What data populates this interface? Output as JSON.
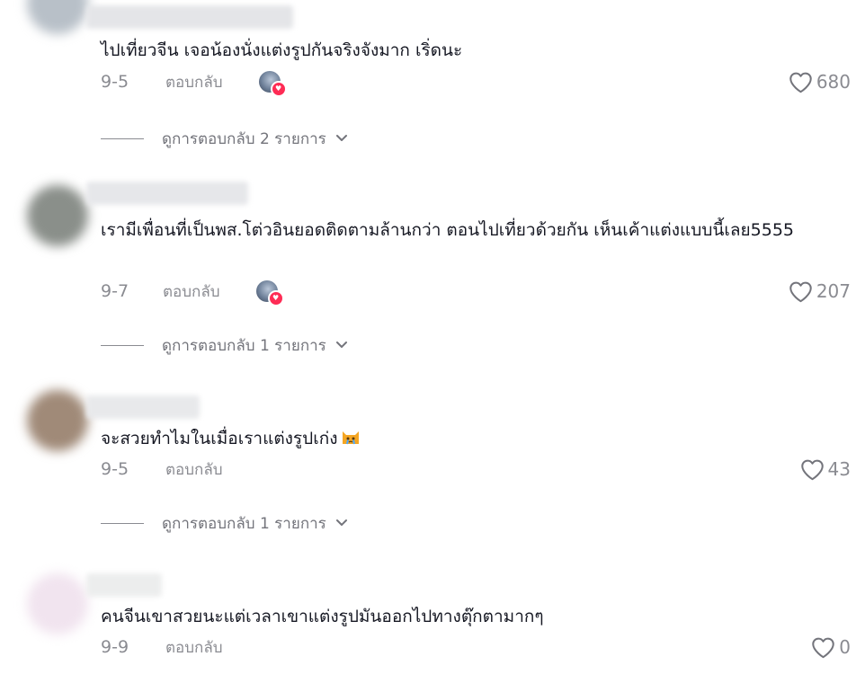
{
  "comments": [
    {
      "text": "ไปเที่ยวจีน เจอน้องนั่งแต่งรูปกันจริงจังมาก เริ่ดนะ",
      "date": "9-5",
      "reply_label": "ตอบกลับ",
      "creator_liked": true,
      "likes": "680",
      "view_replies": "ดูการตอบกลับ 2 รายการ"
    },
    {
      "text": "เรามีเพื่อนที่เป็นพส.โต่วอินยอดติดตามล้านกว่า ตอนไปเที่ยวด้วยกัน เห็นเค้าแต่งแบบนี้เลย5555",
      "date": "9-7",
      "reply_label": "ตอบกลับ",
      "creator_liked": true,
      "likes": "207",
      "view_replies": "ดูการตอบกลับ 1 รายการ"
    },
    {
      "text": "จะสวยทำไมในเมื่อเราแต่งรูปเก่ง",
      "emoji": "crying-cat-emoji",
      "date": "9-5",
      "reply_label": "ตอบกลับ",
      "creator_liked": false,
      "likes": "43",
      "view_replies": "ดูการตอบกลับ 1 รายการ"
    },
    {
      "text": "คนจีนเขาสวยนะแต่เวลาเขาแต่งรูปมันออกไปทางตุ๊กตามากๆ",
      "date": "9-9",
      "reply_label": "ตอบกลับ",
      "creator_liked": false,
      "likes": "0"
    }
  ],
  "icons": {
    "like": "heart-outline-icon",
    "expand": "chevron-down-icon",
    "creator_like_badge": "heart-badge-icon"
  },
  "colors": {
    "text": "#161823",
    "secondary": "#8a8b91",
    "accent": "#fe2c55"
  }
}
